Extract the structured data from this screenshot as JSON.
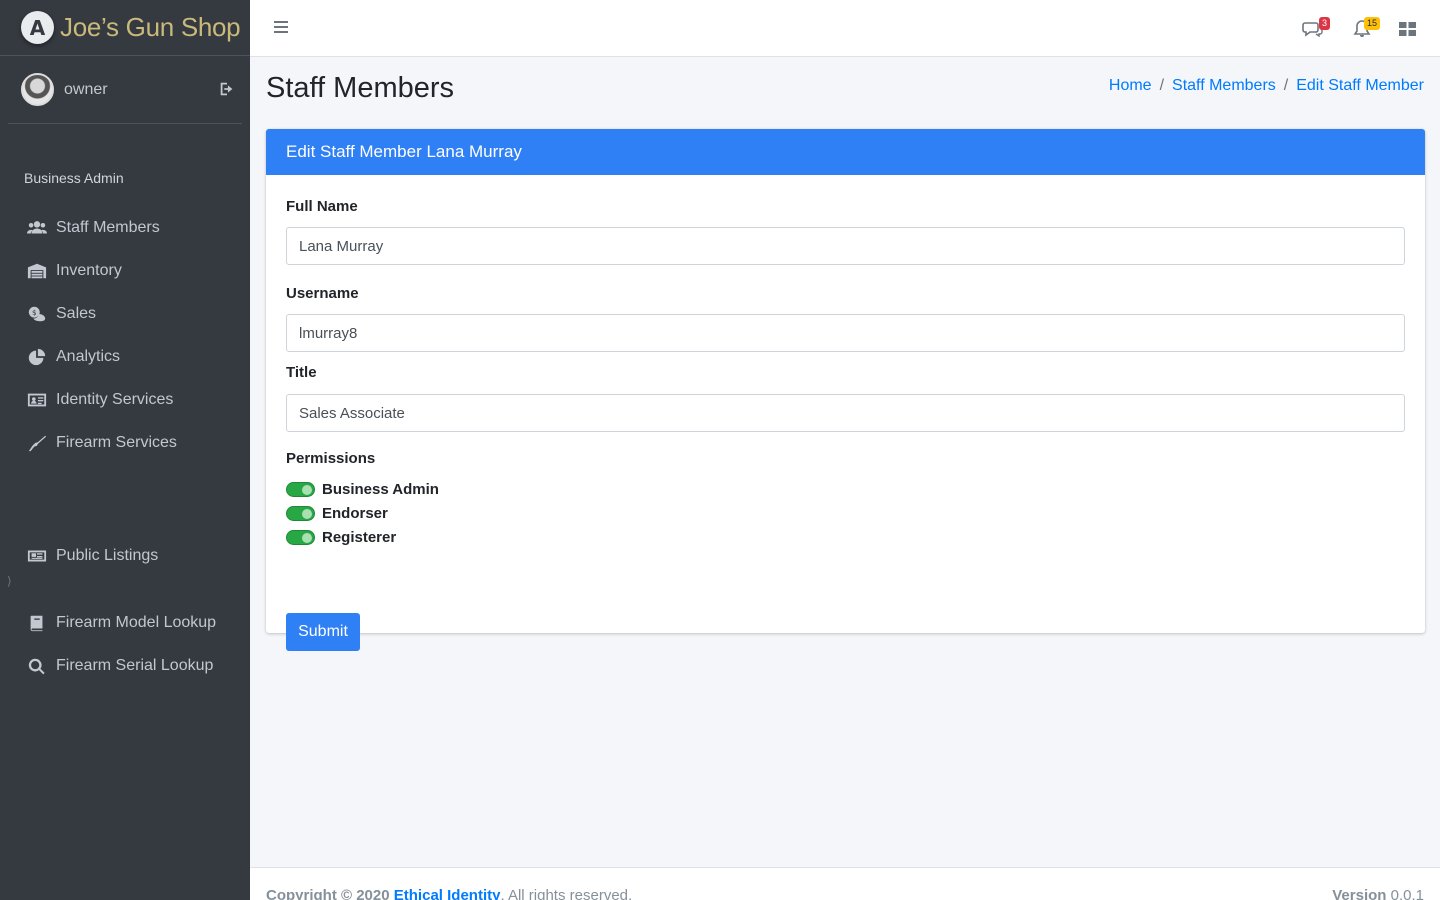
{
  "brand": {
    "logo_letter": "A",
    "name": "Joe’s Gun Shop",
    "color": "#c9b97a"
  },
  "user": {
    "name": "owner"
  },
  "sidebar": {
    "section_header": "Business Admin",
    "items": [
      {
        "label": "Staff Members",
        "icon": "users-icon"
      },
      {
        "label": "Inventory",
        "icon": "warehouse-icon"
      },
      {
        "label": "Sales",
        "icon": "sales-icon"
      },
      {
        "label": "Analytics",
        "icon": "pie-chart-icon"
      },
      {
        "label": "Identity Services",
        "icon": "id-card-icon"
      },
      {
        "label": "Firearm Services",
        "icon": "firearm-icon"
      }
    ],
    "public_listings": "Public Listings",
    "lookup_items": [
      {
        "label": "Firearm Model Lookup",
        "icon": "book-icon"
      },
      {
        "label": "Firearm Serial Lookup",
        "icon": "search-icon"
      }
    ]
  },
  "navbar": {
    "messages_count": "3",
    "notifications_count": "15"
  },
  "page": {
    "title": "Staff Members",
    "breadcrumb": [
      "Home",
      "Staff Members",
      "Edit Staff Member"
    ]
  },
  "card": {
    "header": "Edit Staff Member Lana Murray",
    "full_name_label": "Full Name",
    "full_name_value": "Lana Murray",
    "username_label": "Username",
    "username_value": "lmurray8",
    "title_label": "Title",
    "title_value": "Sales Associate",
    "permissions_label": "Permissions",
    "permissions": [
      {
        "label": "Business Admin",
        "enabled": true
      },
      {
        "label": "Endorser",
        "enabled": true
      },
      {
        "label": "Registerer",
        "enabled": true
      }
    ],
    "submit_label": "Submit"
  },
  "footer": {
    "copyright": "Copyright © 2020",
    "company": "Ethical Identity",
    "rights": ". All rights reserved.",
    "version_label": "Version",
    "version": "0.0.1"
  },
  "colors": {
    "primary": "#2f7ff5",
    "sidebar_bg": "#343a40",
    "toggle_on": "#28a745"
  }
}
